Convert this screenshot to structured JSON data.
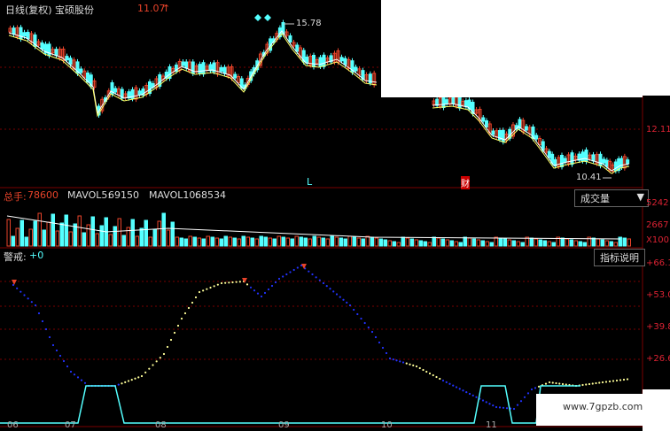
{
  "header": {
    "period": "日线(复权)",
    "stock_name": "宝硕股份",
    "last_price": "11.07",
    "up_arrow": "↑"
  },
  "price_panel": {
    "high_label": "15.78",
    "low_label": "10.41",
    "axis_label": "12.11",
    "marker_L": "L",
    "marker_cai": "财"
  },
  "volume_panel": {
    "total_label": "总手:",
    "total_value": "78600",
    "ma5_label": "MAVOL5:",
    "ma5_value": "69150",
    "ma10_label": "MAVOL10:",
    "ma10_value": "68534",
    "dropdown_label": "成交量",
    "axis_labels": [
      "5242",
      "2667",
      "X100"
    ]
  },
  "indicator_panel": {
    "title": "警戒:",
    "value": "+0",
    "help_button": "指标说明",
    "axis_labels": [
      "+66.1",
      "+53.0",
      "+39.8",
      "+26.6"
    ]
  },
  "date_axis": [
    "06",
    "07",
    "08",
    "09",
    "10",
    "11"
  ],
  "watermark": "www.7gpzb.com",
  "colors": {
    "up": "#e8432a",
    "down": "#54ffff",
    "grid": "#7a0000",
    "ma_white": "#ffffff",
    "ma_yellow": "#ffff66",
    "dots_blue": "#2233ff",
    "dots_yellow": "#ffff99",
    "line_cyan": "#54ffff"
  }
}
